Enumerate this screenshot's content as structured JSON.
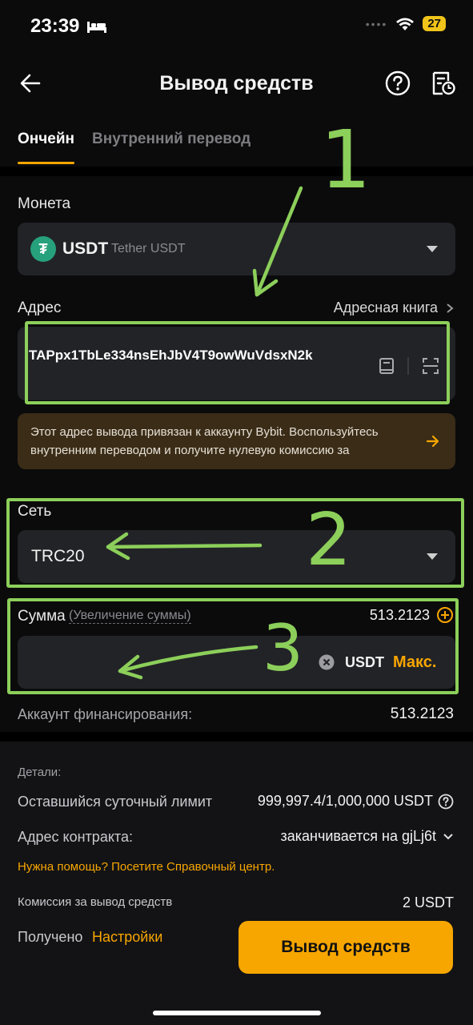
{
  "status": {
    "time": "23:39",
    "battery": "27"
  },
  "header": {
    "title": "Вывод средств"
  },
  "tabs": [
    {
      "label": "Ончейн"
    },
    {
      "label": "Внутренний перевод"
    }
  ],
  "coin": {
    "label": "Монета",
    "symbol": "USDT",
    "name": "Tether USDT"
  },
  "address": {
    "label": "Адрес",
    "book_link": "Адресная книга",
    "value": "TAPpx1TbLe334nsEhJbV4T9owWuVdsxN2k",
    "notice": "Этот адрес вывода привязан к аккаунту Bybit. Воспользуйтесь внутренним переводом и получите нулевую комиссию за"
  },
  "network": {
    "label": "Сеть",
    "value": "TRC20"
  },
  "amount": {
    "label": "Сумма",
    "hint": "(Увеличение суммы)",
    "available": "513.2123",
    "currency": "USDT",
    "max": "Макс."
  },
  "funding": {
    "label": "Аккаунт финансирования:",
    "value": "513.2123"
  },
  "details": {
    "title": "Детали:",
    "limit_label": "Оставшийся суточный лимит",
    "limit_value": "999,997.4/1,000,000 USDT",
    "contract_label": "Адрес контракта:",
    "contract_value": "заканчивается на gjLj6t",
    "help": "Нужна помощь? Посетите Справочный центр."
  },
  "fee": {
    "label": "Комиссия за вывод средств",
    "value": "2 USDT"
  },
  "received": {
    "label": "Получено",
    "settings": "Настройки"
  },
  "submit_label": "Вывод средств",
  "annotations": {
    "one": "1",
    "two": "2",
    "three": "3"
  },
  "colors": {
    "accent": "#f7a600",
    "annotation": "#8ccf5a",
    "field": "#222327"
  }
}
